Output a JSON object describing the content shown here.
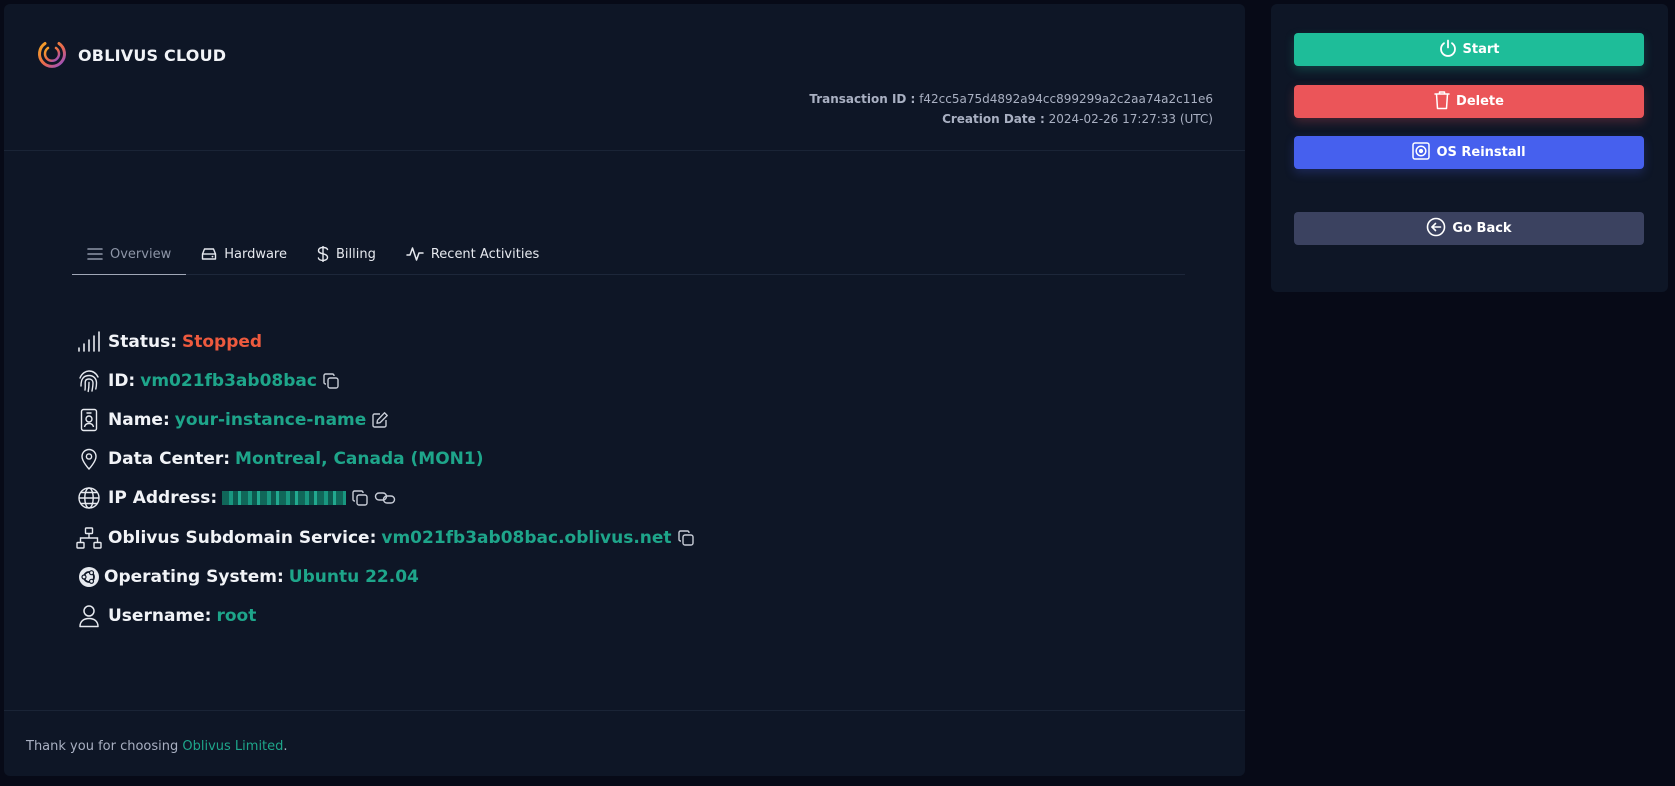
{
  "brand": {
    "name": "OBLIVUS CLOUD"
  },
  "meta": {
    "transaction_label": "Transaction ID :",
    "transaction_id": "f42cc5a75d4892a94cc899299a2c2aa74a2c11e6",
    "creation_label": "Creation Date :",
    "creation_date": "2024-02-26 17:27:33 (UTC)"
  },
  "tabs": [
    {
      "label": "Overview",
      "icon": "list-icon",
      "active": true
    },
    {
      "label": "Hardware",
      "icon": "drive-icon",
      "active": false
    },
    {
      "label": "Billing",
      "icon": "dollar-icon",
      "active": false
    },
    {
      "label": "Recent Activities",
      "icon": "activity-icon",
      "active": false
    }
  ],
  "info": {
    "status": {
      "label": "Status:",
      "value": "Stopped"
    },
    "id": {
      "label": "ID:",
      "value": "vm021fb3ab08bac"
    },
    "name": {
      "label": "Name:",
      "value": "your-instance-name"
    },
    "datacenter": {
      "label": "Data Center:",
      "value": "Montreal, Canada (MON1)"
    },
    "ip": {
      "label": "IP Address:"
    },
    "subdomain": {
      "label": "Oblivus Subdomain Service:",
      "value": "vm021fb3ab08bac.oblivus.net"
    },
    "os": {
      "label": "Operating System:",
      "value": "Ubuntu 22.04"
    },
    "username": {
      "label": "Username:",
      "value": "root"
    }
  },
  "footer": {
    "text": "Thank you for choosing ",
    "link": "Oblivus Limited",
    "suffix": "."
  },
  "actions": {
    "start": "Start",
    "delete": "Delete",
    "reinstall": "OS Reinstall",
    "back": "Go Back"
  },
  "colors": {
    "accent": "#1ea58a",
    "stopped": "#ee5a3e",
    "start": "#1ebd99",
    "delete": "#eb5559",
    "reinstall": "#4660ee",
    "back": "#3b4260"
  }
}
